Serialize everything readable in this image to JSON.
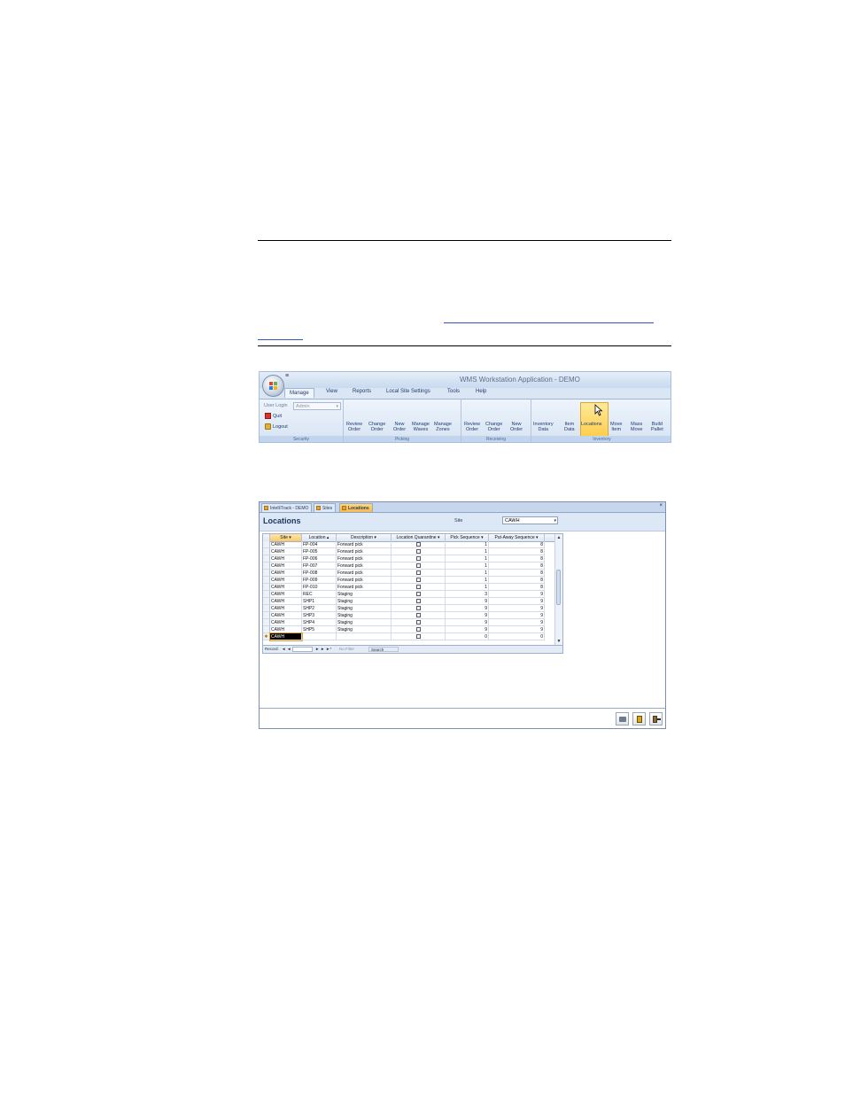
{
  "ribbon": {
    "app_title": "WMS Workstation Application - DEMO",
    "qat_symbol": "≡",
    "tabs": [
      "Manage",
      "View",
      "Reports",
      "Local Site Settings",
      "Tools",
      "Help"
    ],
    "security": {
      "user_login_label": "User Login",
      "user_login_value": "Admin",
      "quit_label": "Quit",
      "logout_label": "Logout",
      "caption": "Security"
    },
    "picking": {
      "caption": "Picking",
      "buttons": [
        {
          "l1": "Review",
          "l2": "Order"
        },
        {
          "l1": "Change",
          "l2": "Order"
        },
        {
          "l1": "New",
          "l2": "Order"
        },
        {
          "l1": "Manage",
          "l2": "Waves"
        },
        {
          "l1": "Manage",
          "l2": "Zones"
        }
      ]
    },
    "receiving": {
      "caption": "Receiving",
      "buttons": [
        {
          "l1": "Review",
          "l2": "Order"
        },
        {
          "l1": "Change",
          "l2": "Order"
        },
        {
          "l1": "New",
          "l2": "Order"
        }
      ]
    },
    "inventory": {
      "caption": "Inventory",
      "buttons": [
        {
          "l1": "Inventory",
          "l2": "Data"
        },
        {
          "l1": "Item",
          "l2": "Data"
        },
        {
          "l1": "Locations",
          "l2": ""
        },
        {
          "l1": "Move",
          "l2": "Item"
        },
        {
          "l1": "Mass",
          "l2": "Move"
        },
        {
          "l1": "Build",
          "l2": "Pallet"
        }
      ]
    }
  },
  "window": {
    "doc_tabs": [
      "IntelliTrack - DEMO",
      "Sites",
      "Locations"
    ],
    "close_symbol": "×",
    "form_title": "Locations",
    "site_label": "Site",
    "site_value": "CAWH",
    "grid": {
      "columns": [
        "Site",
        "Location",
        "Description",
        "Location Quarantine",
        "Pick Sequence",
        "Put-Away Sequence"
      ],
      "rows": [
        [
          "CAWH",
          "FP-004",
          "Forward pick",
          "",
          "1",
          "8"
        ],
        [
          "CAWH",
          "FP-005",
          "Forward pick",
          "",
          "1",
          "8"
        ],
        [
          "CAWH",
          "FP-006",
          "Forward pick",
          "",
          "1",
          "8"
        ],
        [
          "CAWH",
          "FP-007",
          "Forward pick",
          "",
          "1",
          "8"
        ],
        [
          "CAWH",
          "FP-008",
          "Forward pick",
          "",
          "1",
          "8"
        ],
        [
          "CAWH",
          "FP-009",
          "Forward pick",
          "",
          "1",
          "8"
        ],
        [
          "CAWH",
          "FP-010",
          "Forward pick",
          "",
          "1",
          "8"
        ],
        [
          "CAWH",
          "REC",
          "Staging",
          "",
          "3",
          "9"
        ],
        [
          "CAWH",
          "SHP1",
          "Staging",
          "",
          "9",
          "9"
        ],
        [
          "CAWH",
          "SHP2",
          "Staging",
          "",
          "9",
          "9"
        ],
        [
          "CAWH",
          "SHP3",
          "Staging",
          "",
          "9",
          "9"
        ],
        [
          "CAWH",
          "SHP4",
          "Staging",
          "",
          "9",
          "9"
        ],
        [
          "CAWH",
          "SHP5",
          "Staging",
          "",
          "9",
          "9"
        ],
        [
          "CAWH",
          "",
          "",
          "",
          "0",
          "0"
        ]
      ],
      "navbar": {
        "record_label": "Record:",
        "first": "◄",
        "prev": "◄",
        "next": "►",
        "last": "►",
        "new": "►*",
        "filter_label": "No Filter",
        "search_label": "Search"
      }
    }
  },
  "colors": {
    "accent": "#ffcc45",
    "ribbon_bg": "#dbe6f4",
    "title_text": "#1b365f"
  }
}
